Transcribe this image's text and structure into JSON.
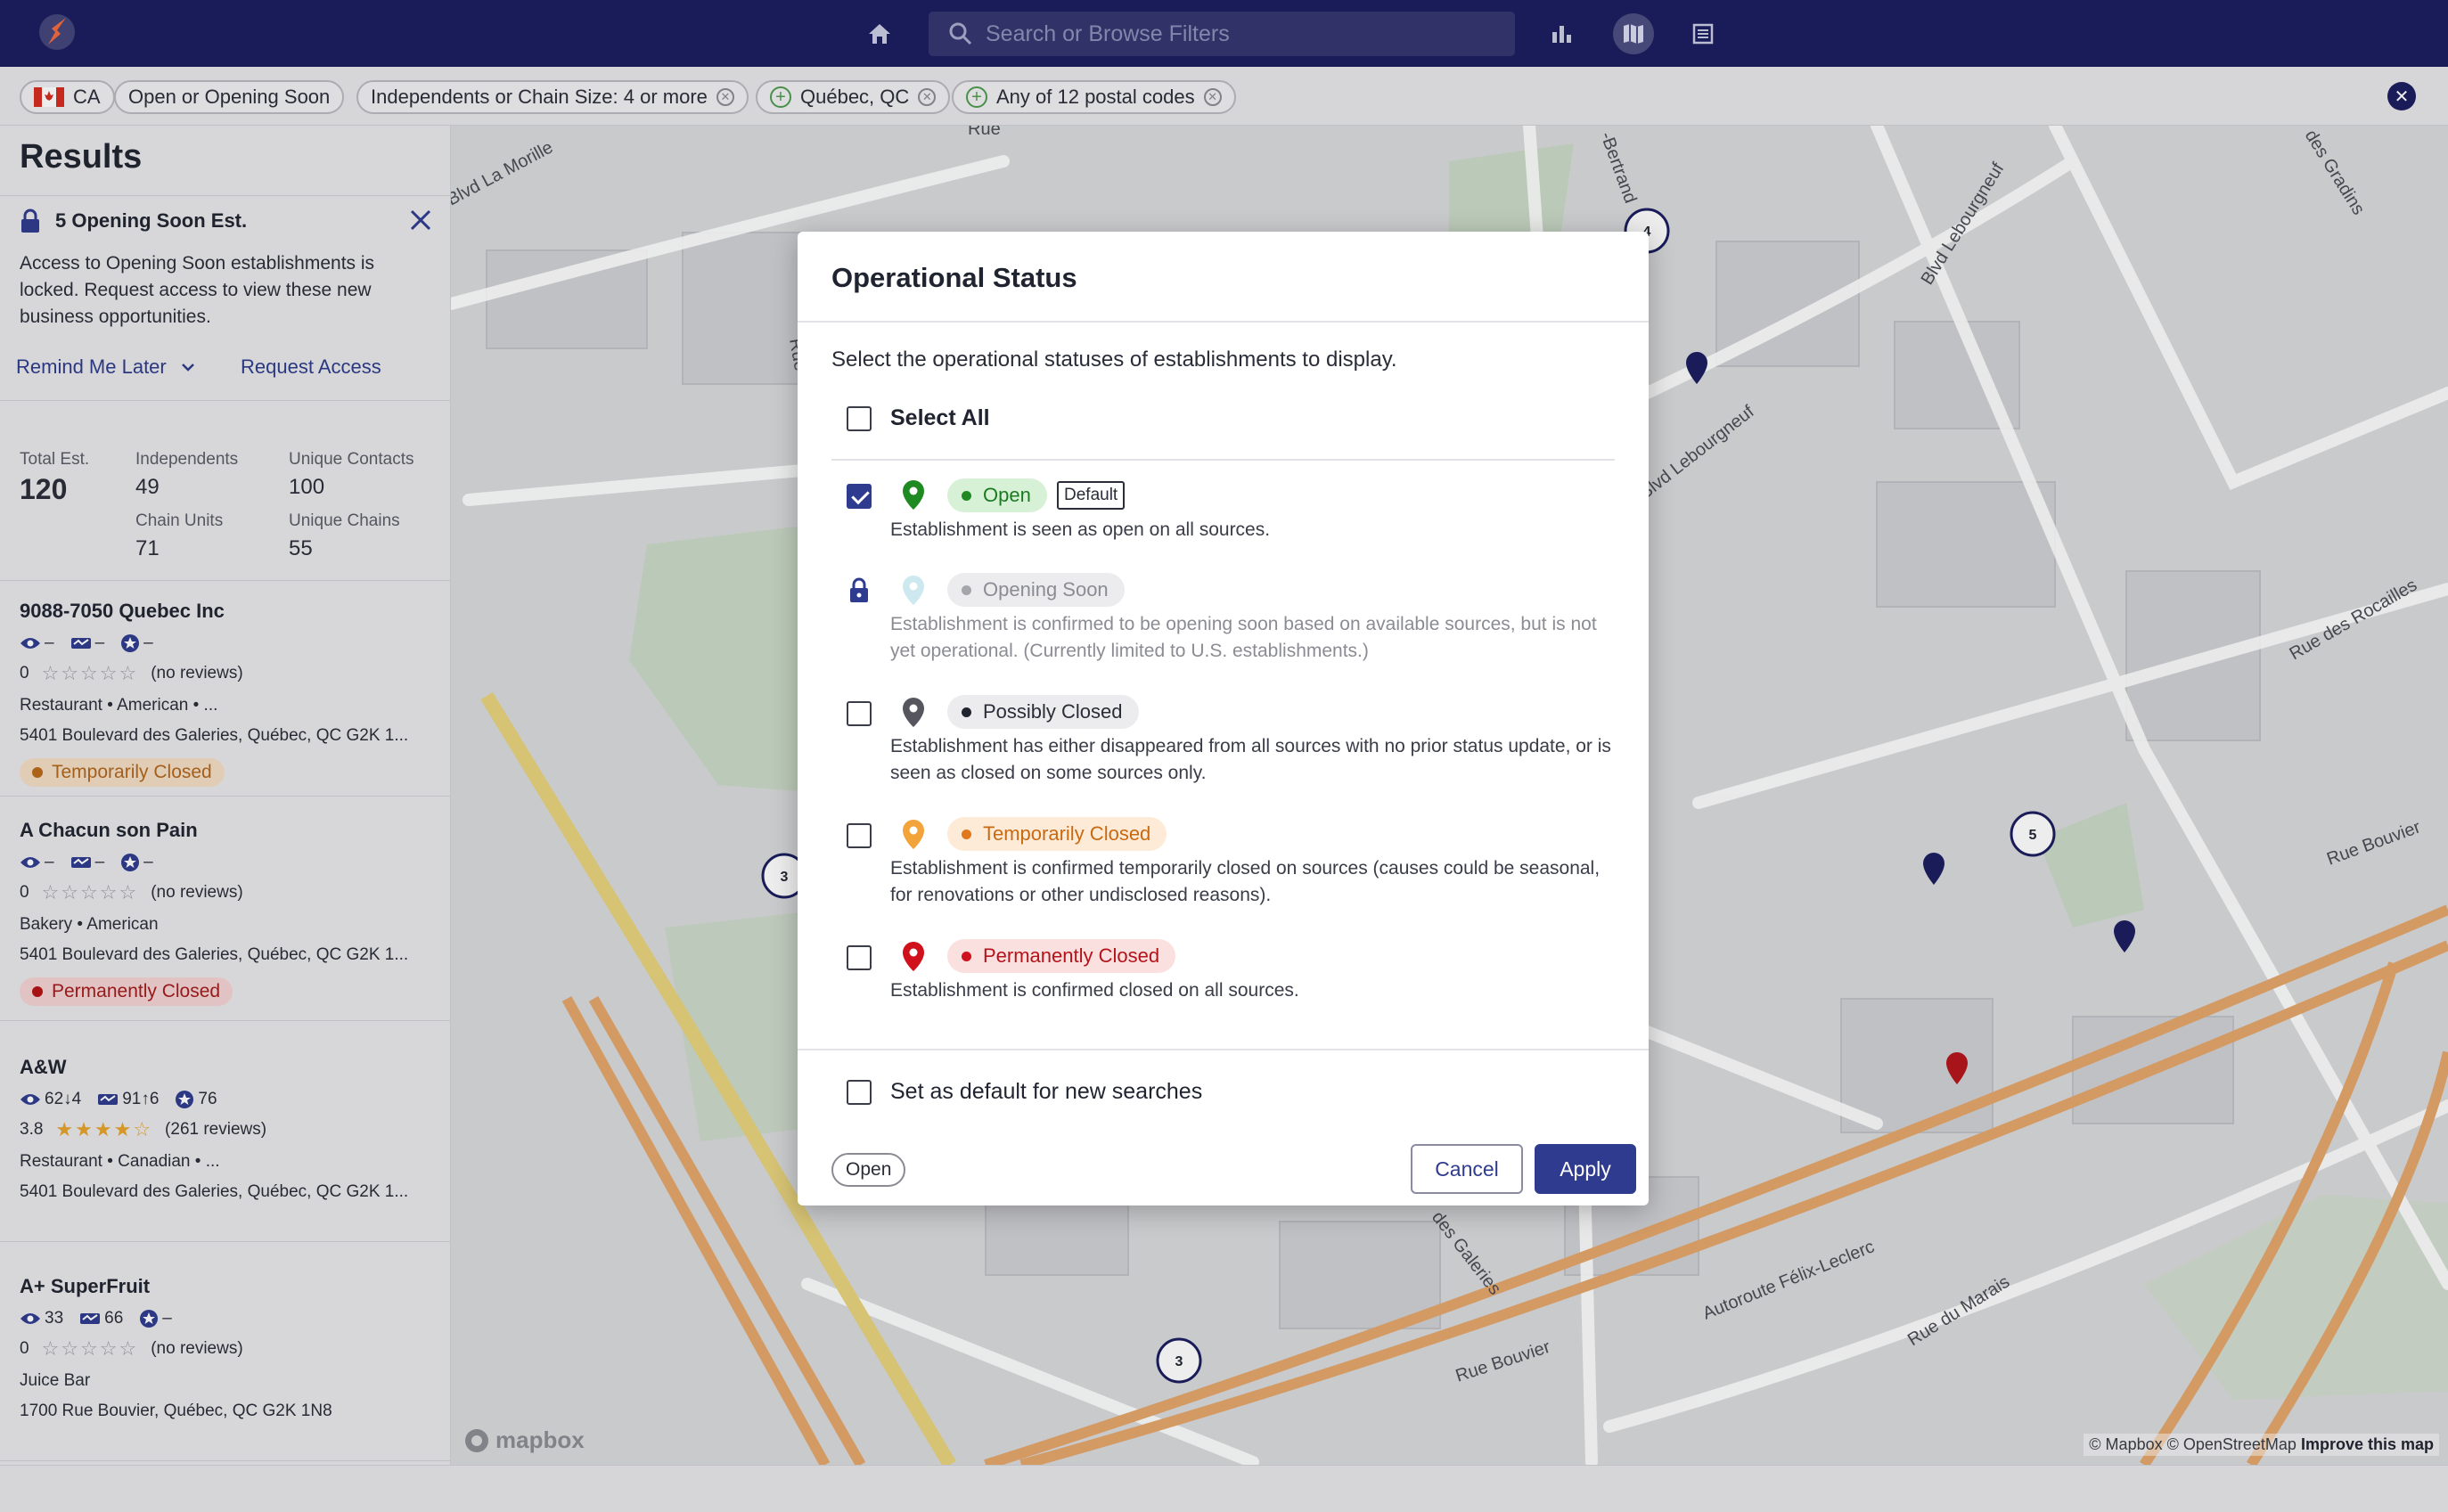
{
  "topbar": {
    "search_placeholder": "Search or Browse Filters"
  },
  "filters": {
    "country": "CA",
    "chips": [
      "Open or Opening Soon",
      "Independents or Chain Size: 4 or more",
      "Québec, QC",
      "Any of 12 postal codes"
    ]
  },
  "sidebar": {
    "title": "Results",
    "notice": {
      "title": "5 Opening Soon Est.",
      "body": "Access to Opening Soon establishments is locked. Request access to view these new business opportunities.",
      "remind_label": "Remind Me Later",
      "request_label": "Request Access"
    },
    "stats": {
      "total_label": "Total Est.",
      "total_value": "120",
      "independents_label": "Independents",
      "independents_value": "49",
      "unique_contacts_label": "Unique Contacts",
      "unique_contacts_value": "100",
      "chain_units_label": "Chain Units",
      "chain_units_value": "71",
      "unique_chains_label": "Unique Chains",
      "unique_chains_value": "55"
    },
    "results": [
      {
        "name": "9088-7050 Quebec Inc",
        "views": "–",
        "traffic": "–",
        "score": "–",
        "rating": "0",
        "stars": "☆☆☆☆☆",
        "reviews": "(no reviews)",
        "category": "Restaurant • American • ...",
        "address": "5401 Boulevard des Galeries, Québec, QC G2K 1...",
        "status": "Temporarily Closed"
      },
      {
        "name": "A Chacun son Pain",
        "views": "–",
        "traffic": "–",
        "score": "–",
        "rating": "0",
        "stars": "☆☆☆☆☆",
        "reviews": "(no reviews)",
        "category": "Bakery • American",
        "address": "5401 Boulevard des Galeries, Québec, QC G2K 1...",
        "status": "Permanently Closed"
      },
      {
        "name": "A&W",
        "views": "62↓4",
        "traffic": "91↑6",
        "score": "76",
        "rating": "3.8",
        "stars": "★★★★☆",
        "reviews": "(261 reviews)",
        "category": "Restaurant • Canadian • ...",
        "address": "5401 Boulevard des Galeries, Québec, QC G2K 1..."
      },
      {
        "name": "A+ SuperFruit",
        "views": "33",
        "traffic": "66",
        "score": "–",
        "rating": "0",
        "stars": "☆☆☆☆☆",
        "reviews": "(no reviews)",
        "category": "Juice Bar",
        "address": "1700 Rue Bouvier, Québec, QC G2K 1N8"
      }
    ]
  },
  "map": {
    "streets": [
      "Rue",
      "Blvd La Morille",
      "Rue",
      "-Bertrand",
      "Blvd Lebourgneuf",
      "Blvd Lebourgneuf",
      "des Gradins",
      "Rue des Rocailles",
      "Rue Bouvier",
      "Autoroute Félix-Leclerc",
      "Rue du Marais",
      "Rue Bouvier",
      "des Galeries"
    ],
    "clusters": [
      "4",
      "3",
      "5",
      "3"
    ],
    "logo": "mapbox",
    "attribution": "© Mapbox © OpenStreetMap",
    "improve": "Improve this map"
  },
  "modal": {
    "title": "Operational Status",
    "description": "Select the operational statuses of establishments to display.",
    "select_all": "Select All",
    "options": [
      {
        "label": "Open",
        "checked": true,
        "tag": "Default",
        "desc": "Establishment is seen as open on all sources."
      },
      {
        "label": "Opening Soon",
        "locked": true,
        "desc": "Establishment is confirmed to be opening soon based on available sources, but is not yet operational. (Currently limited to U.S. establishments.)"
      },
      {
        "label": "Possibly Closed",
        "checked": false,
        "desc": "Establishment has either disappeared from all sources with no prior status update, or is seen as closed on some sources only."
      },
      {
        "label": "Temporarily Closed",
        "checked": false,
        "desc": "Establishment is confirmed temporarily closed on sources (causes could be seasonal, for renovations or other undisclosed reasons)."
      },
      {
        "label": "Permanently Closed",
        "checked": false,
        "desc": "Establishment is confirmed closed on all sources."
      }
    ],
    "default_label": "Set as default for new searches",
    "summary_chip": "Open",
    "cancel_label": "Cancel",
    "apply_label": "Apply"
  },
  "colors": {
    "nav": "#1a1d5e",
    "primary": "#2e3b8e",
    "open": "#1f8a22",
    "temp": "#e0771a",
    "perm": "#d0101a"
  }
}
